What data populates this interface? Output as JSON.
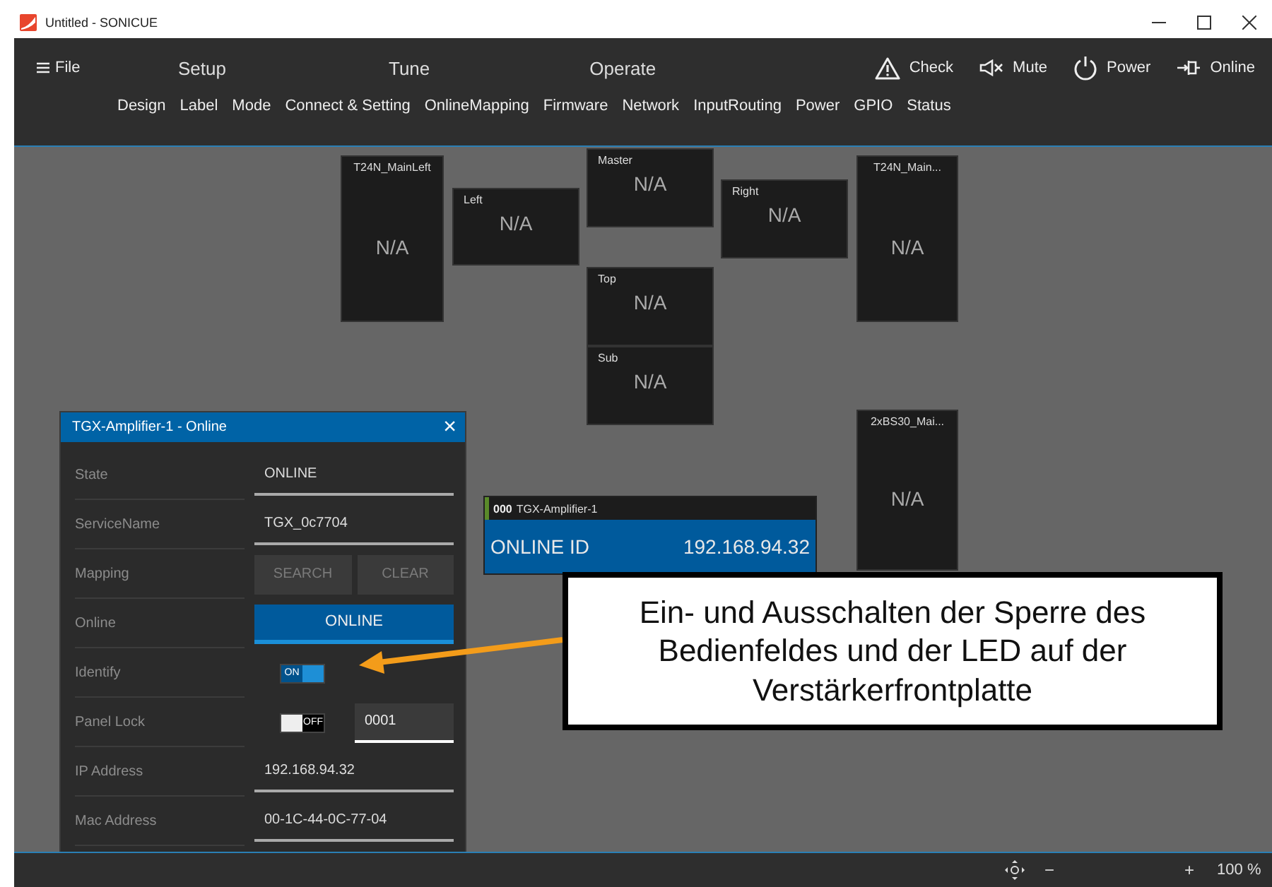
{
  "window": {
    "title": "Untitled - SONICUE"
  },
  "menu": {
    "label": "File"
  },
  "main_tabs": [
    "Setup",
    "Tune",
    "Operate"
  ],
  "actions": [
    {
      "kind": "check",
      "label": "Check"
    },
    {
      "kind": "mute",
      "label": "Mute"
    },
    {
      "kind": "power",
      "label": "Power"
    },
    {
      "kind": "online",
      "label": "Online"
    }
  ],
  "sub_tabs": [
    "Design",
    "Label",
    "Mode",
    "Connect & Setting",
    "OnlineMapping",
    "Firmware",
    "Network",
    "InputRouting",
    "Power",
    "GPIO",
    "Status"
  ],
  "nodes": [
    {
      "title": "T24N_MainLeft",
      "value": "N/A",
      "kind": "tall"
    },
    {
      "title": "Left",
      "value": "N/A",
      "kind": "short"
    },
    {
      "title": "Master",
      "value": "N/A",
      "kind": "short"
    },
    {
      "title": "Right",
      "value": "N/A",
      "kind": "short"
    },
    {
      "title": "T24N_Main...",
      "value": "N/A",
      "kind": "tall"
    },
    {
      "title": "Top",
      "value": "N/A",
      "kind": "short"
    },
    {
      "title": "Sub",
      "value": "N/A",
      "kind": "short"
    },
    {
      "title": "2xBS30_Mai...",
      "value": "N/A",
      "kind": "tall"
    }
  ],
  "amplifier": {
    "number": "000",
    "name": "TGX-Amplifier-1",
    "status": "ONLINE ID",
    "ip": "192.168.94.32"
  },
  "dialog": {
    "title": "TGX-Amplifier-1 - Online",
    "close": "×",
    "rows": [
      {
        "label": "State",
        "kind": "text",
        "value": "ONLINE"
      },
      {
        "label": "ServiceName",
        "kind": "text",
        "value": "TGX_0c7704"
      },
      {
        "label": "Mapping",
        "kind": "buttons",
        "buttons": [
          {
            "label": "SEARCH",
            "disabled": true
          },
          {
            "label": "CLEAR",
            "disabled": true
          }
        ]
      },
      {
        "label": "Online",
        "kind": "button",
        "value": "ONLINE"
      },
      {
        "label": "Identify",
        "kind": "toggle",
        "toggle": {
          "on": true,
          "label": "ON"
        }
      },
      {
        "label": "Panel Lock",
        "kind": "toggle_field",
        "toggle": {
          "on": false,
          "label": "OFF"
        },
        "value": "0001"
      },
      {
        "label": "IP Address",
        "kind": "text",
        "value": "192.168.94.32"
      },
      {
        "label": "Mac Address",
        "kind": "text",
        "value": "00-1C-44-0C-77-04"
      }
    ]
  },
  "callout": {
    "text": "Ein- und Ausschalten der Sperre des Bedienfeldes und der LED auf der Verstärkerfrontplatte"
  },
  "status_bar": {
    "minus": "−",
    "plus": "+",
    "zoom": "100 %"
  }
}
